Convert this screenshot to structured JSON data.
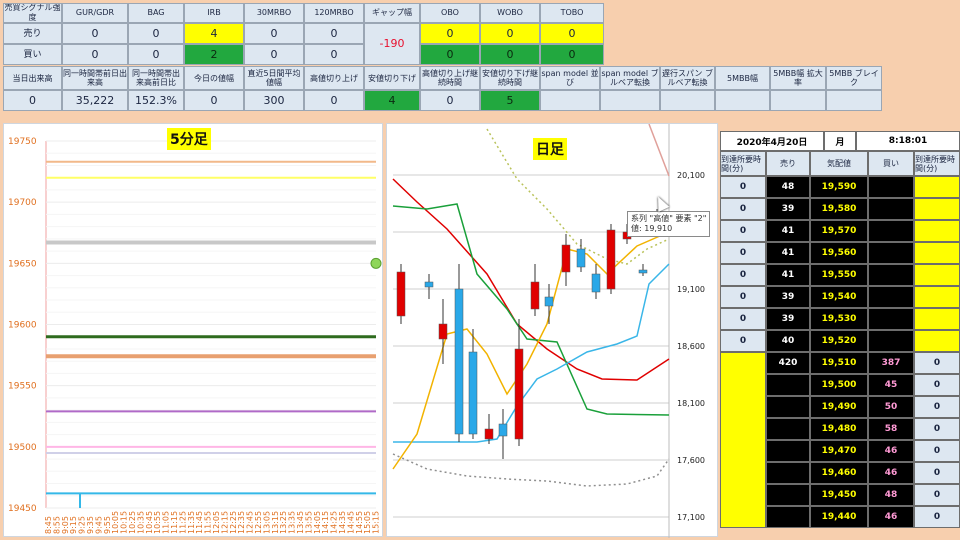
{
  "signal_table": {
    "headers": [
      "売買シグナル強度",
      "GUR/GDR",
      "BAG",
      "IRB",
      "30MRBO",
      "120MRBO",
      "ギャップ幅",
      "OBO",
      "WOBO",
      "TOBO"
    ],
    "sell_label": "売り",
    "buy_label": "買い",
    "sell_values": [
      "0",
      "0",
      "4",
      "0",
      "0",
      "0",
      "0",
      "0"
    ],
    "buy_values": [
      "0",
      "0",
      "2",
      "0",
      "0",
      "0",
      "0",
      "0"
    ],
    "gap_value": "-190",
    "headers2": [
      "当日出来高",
      "同一時間帯前日出来高",
      "同一時間帯出来高前日比",
      "今日の値幅",
      "直近5日間平均値幅",
      "高値切り上げ",
      "安値切り下げ",
      "高値切り上げ継続時間",
      "安値切り下げ継続時間",
      "span model 並び",
      "span model ブルベア転換",
      "遅行スパン ブルベア転換",
      "5MBB幅",
      "5MBB幅 拡大率",
      "5MBB ブレイク"
    ],
    "values2": [
      "0",
      "35,222",
      "152.3%",
      "0",
      "300",
      "0",
      "4",
      "0",
      "5",
      "",
      "",
      "",
      "",
      "",
      ""
    ]
  },
  "chart_5min": {
    "title": "5分足",
    "y_ticks": [
      "19750",
      "19700",
      "19650",
      "19600",
      "19550",
      "19500",
      "19450"
    ],
    "x_ticks": [
      "8:45",
      "8:55",
      "9:05",
      "9:15",
      "9:25",
      "9:35",
      "9:45",
      "9:55",
      "10:05",
      "10:15",
      "10:25",
      "10:35",
      "10:45",
      "10:55",
      "11:05",
      "11:15",
      "11:25",
      "11:35",
      "11:45",
      "11:55",
      "12:05",
      "12:15",
      "12:25",
      "12:35",
      "12:45",
      "12:55",
      "13:05",
      "13:15",
      "13:25",
      "13:35",
      "13:45",
      "13:55",
      "14:05",
      "14:15",
      "14:25",
      "14:35",
      "14:45",
      "14:55",
      "15:05",
      "15:15"
    ],
    "level_lines": [
      {
        "value": 19733,
        "color": "#f2b98a"
      },
      {
        "value": 19720,
        "color": "#ffff66"
      },
      {
        "value": 19667,
        "color": "#c8c8c8"
      },
      {
        "value": 19590,
        "color": "#2e6b1e"
      },
      {
        "value": 19574,
        "color": "#e8a070"
      },
      {
        "value": 19529,
        "color": "#b06ac8"
      },
      {
        "value": 19500,
        "color": "#ffb6e6"
      },
      {
        "value": 19495,
        "color": "#d0d0e8"
      },
      {
        "value": 19462,
        "color": "#34b8e8"
      }
    ]
  },
  "chart_daily": {
    "title": "日足",
    "y_ticks": [
      "20,100",
      "19,100",
      "18,600",
      "18,100",
      "17,600",
      "17,100"
    ],
    "tooltip": {
      "line1": "系列 \"高値\" 要素 \"2\"",
      "line2": "値: 19,910"
    }
  },
  "board": {
    "date": "2020年4月20日",
    "weekday": "月",
    "time": "8:18:01",
    "col_headers": [
      "到達所要時間(分)",
      "売り",
      "気配値",
      "買い",
      "到達所要時間(分)"
    ],
    "ask_rows": [
      {
        "time": "0",
        "sell": "48",
        "price": "19,590"
      },
      {
        "time": "0",
        "sell": "39",
        "price": "19,580"
      },
      {
        "time": "0",
        "sell": "41",
        "price": "19,570"
      },
      {
        "time": "0",
        "sell": "41",
        "price": "19,560"
      },
      {
        "time": "0",
        "sell": "41",
        "price": "19,550"
      },
      {
        "time": "0",
        "sell": "39",
        "price": "19,540"
      },
      {
        "time": "0",
        "sell": "39",
        "price": "19,530"
      },
      {
        "time": "0",
        "sell": "40",
        "price": "19,520"
      }
    ],
    "mid_row": {
      "sell": "420",
      "price": "19,510",
      "buy": "387",
      "time": "0"
    },
    "bid_rows": [
      {
        "price": "19,500",
        "buy": "45",
        "time": "0"
      },
      {
        "price": "19,490",
        "buy": "50",
        "time": "0"
      },
      {
        "price": "19,480",
        "buy": "58",
        "time": "0"
      },
      {
        "price": "19,470",
        "buy": "46",
        "time": "0"
      },
      {
        "price": "19,460",
        "buy": "46",
        "time": "0"
      },
      {
        "price": "19,450",
        "buy": "48",
        "time": "0"
      },
      {
        "price": "19,440",
        "buy": "46",
        "time": "0"
      }
    ]
  },
  "colors": {
    "yellow": "#ffff00",
    "green": "#22a83f",
    "red_candle": "#e00000",
    "blue_candle": "#2aa8e8"
  }
}
